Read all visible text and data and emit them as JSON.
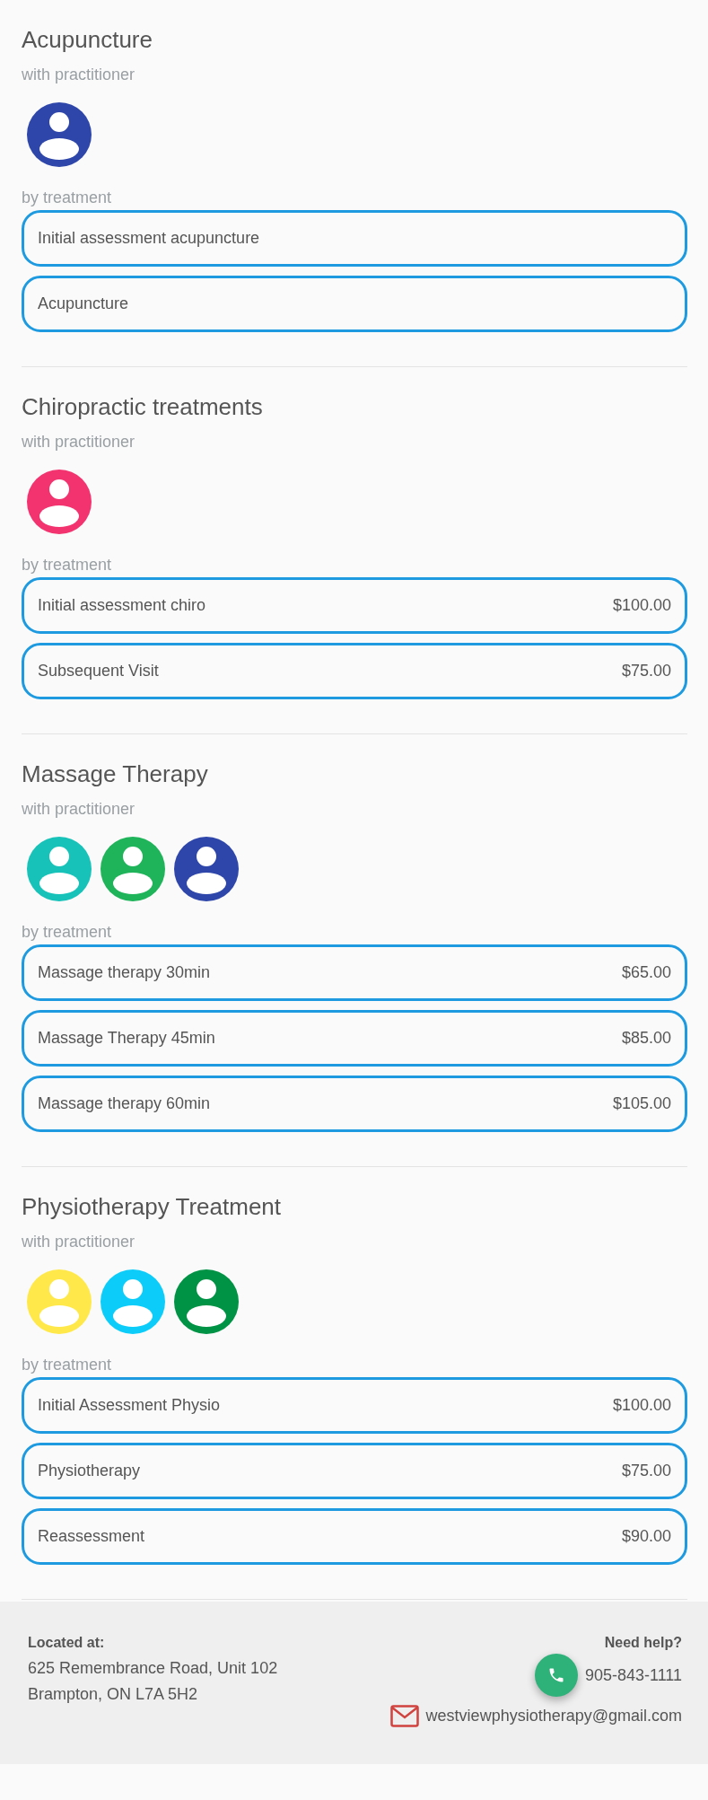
{
  "services": [
    {
      "title": "Acupuncture",
      "practitioner_label": "with practitioner",
      "practitioners": [
        {
          "color": "#2e46a9"
        }
      ],
      "treatment_label": "by treatment",
      "treatments": [
        {
          "name": "Initial assessment acupuncture"
        },
        {
          "name": "Acupuncture"
        }
      ]
    },
    {
      "title": "Chiropractic treatments",
      "practitioner_label": "with practitioner",
      "practitioners": [
        {
          "color": "#f2336f"
        }
      ],
      "treatment_label": "by treatment",
      "treatments": [
        {
          "name": "Initial assessment chiro",
          "price": "$100.00"
        },
        {
          "name": "Subsequent Visit",
          "price": "$75.00"
        }
      ]
    },
    {
      "title": "Massage Therapy",
      "practitioner_label": "with practitioner",
      "practitioners": [
        {
          "color": "#17c2b8"
        },
        {
          "color": "#1fb35a"
        },
        {
          "color": "#2e46a9"
        }
      ],
      "treatment_label": "by treatment",
      "treatments": [
        {
          "name": "Massage therapy 30min",
          "price": "$65.00"
        },
        {
          "name": "Massage Therapy 45min",
          "price": "$85.00"
        },
        {
          "name": "Massage therapy 60min",
          "price": "$105.00"
        }
      ]
    },
    {
      "title": "Physiotherapy Treatment",
      "practitioner_label": "with practitioner",
      "practitioners": [
        {
          "color": "#ffe94a"
        },
        {
          "color": "#0ccdfa"
        },
        {
          "color": "#009245"
        }
      ],
      "treatment_label": "by treatment",
      "treatments": [
        {
          "name": "Initial Assessment Physio",
          "price": "$100.00"
        },
        {
          "name": "Physiotherapy",
          "price": "$75.00"
        },
        {
          "name": "Reassessment",
          "price": "$90.00"
        }
      ]
    }
  ],
  "footer": {
    "location_label": "Located at:",
    "address_lines": [
      "625 Remembrance Road, Unit 102",
      "Brampton, ON L7A 5H2"
    ],
    "help_label": "Need help?",
    "phone": "905-843-1111",
    "email": "westviewphysiotherapy@gmail.com"
  }
}
